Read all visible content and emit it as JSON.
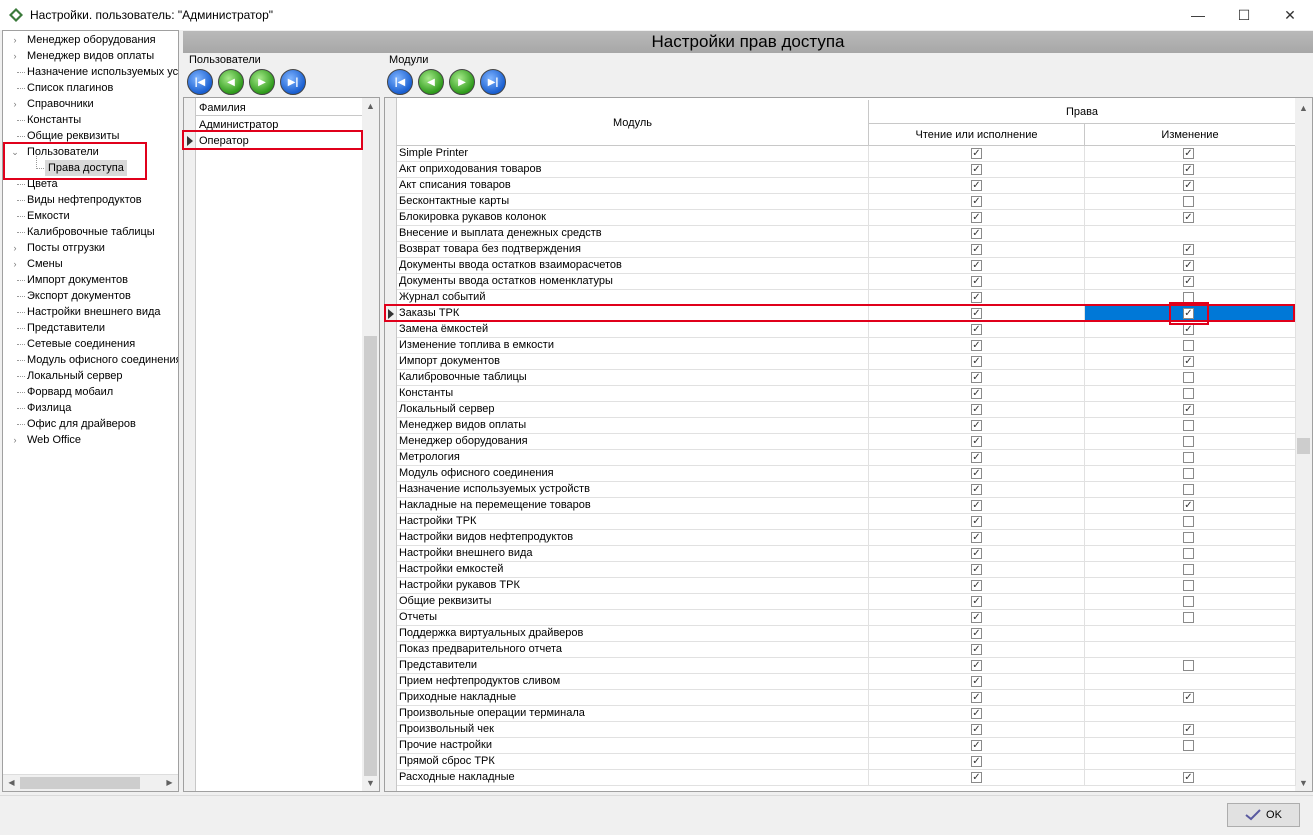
{
  "window": {
    "title": "Настройки. пользователь: \"Администратор\"",
    "minimize": "—",
    "maximize": "☐",
    "close": "✕"
  },
  "tree": {
    "items": [
      {
        "label": "Менеджер оборудования",
        "expandable": true
      },
      {
        "label": "Менеджер видов оплаты",
        "expandable": true
      },
      {
        "label": "Назначение используемых уст",
        "expandable": false
      },
      {
        "label": "Список плагинов",
        "expandable": false
      },
      {
        "label": "Справочники",
        "expandable": true
      },
      {
        "label": "Константы",
        "expandable": false
      },
      {
        "label": "Общие реквизиты",
        "expandable": false
      },
      {
        "label": "Пользователи",
        "expandable": true,
        "expanded": true
      },
      {
        "label": "Права доступа",
        "child": true,
        "selected": true
      },
      {
        "label": "Цвета",
        "expandable": false
      },
      {
        "label": "Виды нефтепродуктов",
        "expandable": false
      },
      {
        "label": "Емкости",
        "expandable": false
      },
      {
        "label": "Калибровочные таблицы",
        "expandable": false
      },
      {
        "label": "Посты отгрузки",
        "expandable": true
      },
      {
        "label": "Смены",
        "expandable": true
      },
      {
        "label": "Импорт документов",
        "expandable": false
      },
      {
        "label": "Экспорт документов",
        "expandable": false
      },
      {
        "label": "Настройки внешнего вида",
        "expandable": false
      },
      {
        "label": "Представители",
        "expandable": false
      },
      {
        "label": "Сетевые соединения",
        "expandable": false
      },
      {
        "label": "Модуль офисного соединения",
        "expandable": false
      },
      {
        "label": "Локальный сервер",
        "expandable": false
      },
      {
        "label": "Форвард мобаил",
        "expandable": false
      },
      {
        "label": "Физлица",
        "expandable": false
      },
      {
        "label": "Офис для драйверов",
        "expandable": false
      },
      {
        "label": "Web Office",
        "expandable": true
      }
    ]
  },
  "header": {
    "title": "Настройки прав доступа"
  },
  "users": {
    "section_label": "Пользователи",
    "column_header": "Фамилия",
    "rows": [
      "Администратор",
      "Оператор"
    ],
    "selected_index": 1
  },
  "modules": {
    "section_label": "Модули",
    "col_module": "Модуль",
    "col_rights": "Права",
    "col_read": "Чтение или исполнение",
    "col_edit": "Изменение",
    "selected_index": 10,
    "rows": [
      {
        "name": "Simple Printer",
        "read": true,
        "edit": true
      },
      {
        "name": "Акт оприходования товаров",
        "read": true,
        "edit": true
      },
      {
        "name": "Акт списания товаров",
        "read": true,
        "edit": true
      },
      {
        "name": "Бесконтактные карты",
        "read": true,
        "edit": false
      },
      {
        "name": "Блокировка рукавов колонок",
        "read": true,
        "edit": true
      },
      {
        "name": "Внесение и выплата денежных средств",
        "read": true,
        "edit": null
      },
      {
        "name": "Возврат товара без подтверждения",
        "read": true,
        "edit": true
      },
      {
        "name": "Документы ввода остатков взаиморасчетов",
        "read": true,
        "edit": true
      },
      {
        "name": "Документы ввода остатков номенклатуры",
        "read": true,
        "edit": true
      },
      {
        "name": "Журнал событий",
        "read": true,
        "edit": false
      },
      {
        "name": "Заказы ТРК",
        "read": true,
        "edit": true
      },
      {
        "name": "Замена ёмкостей",
        "read": true,
        "edit": true
      },
      {
        "name": "Изменение топлива в емкости",
        "read": true,
        "edit": false
      },
      {
        "name": "Импорт документов",
        "read": true,
        "edit": true
      },
      {
        "name": "Калибровочные таблицы",
        "read": true,
        "edit": false
      },
      {
        "name": "Константы",
        "read": true,
        "edit": false
      },
      {
        "name": "Локальный сервер",
        "read": true,
        "edit": true
      },
      {
        "name": "Менеджер видов оплаты",
        "read": true,
        "edit": false
      },
      {
        "name": "Менеджер оборудования",
        "read": true,
        "edit": false
      },
      {
        "name": "Метрология",
        "read": true,
        "edit": false
      },
      {
        "name": "Модуль офисного соединения",
        "read": true,
        "edit": false
      },
      {
        "name": "Назначение используемых устройств",
        "read": true,
        "edit": false
      },
      {
        "name": "Накладные на перемещение товаров",
        "read": true,
        "edit": true
      },
      {
        "name": "Настройки ТРК",
        "read": true,
        "edit": false
      },
      {
        "name": "Настройки видов нефтепродуктов",
        "read": true,
        "edit": false
      },
      {
        "name": "Настройки внешнего вида",
        "read": true,
        "edit": false
      },
      {
        "name": "Настройки емкостей",
        "read": true,
        "edit": false
      },
      {
        "name": "Настройки рукавов ТРК",
        "read": true,
        "edit": false
      },
      {
        "name": "Общие реквизиты",
        "read": true,
        "edit": false
      },
      {
        "name": "Отчеты",
        "read": true,
        "edit": false
      },
      {
        "name": "Поддержка виртуальных драйверов",
        "read": true,
        "edit": null
      },
      {
        "name": "Показ предварительного отчета",
        "read": true,
        "edit": null
      },
      {
        "name": "Представители",
        "read": true,
        "edit": false
      },
      {
        "name": "Прием нефтепродуктов сливом",
        "read": true,
        "edit": null
      },
      {
        "name": "Приходные накладные",
        "read": true,
        "edit": true
      },
      {
        "name": "Произвольные операции терминала",
        "read": true,
        "edit": null
      },
      {
        "name": "Произвольный чек",
        "read": true,
        "edit": true
      },
      {
        "name": "Прочие настройки",
        "read": true,
        "edit": false
      },
      {
        "name": "Прямой сброс ТРК",
        "read": true,
        "edit": null
      },
      {
        "name": "Расходные накладные",
        "read": true,
        "edit": true
      }
    ]
  },
  "footer": {
    "ok_label": "OK"
  },
  "colors": {
    "selection": "#0078d7",
    "highlight": "#e0001b",
    "header": "#a9a9a9"
  },
  "icons": {
    "check": "✓"
  }
}
